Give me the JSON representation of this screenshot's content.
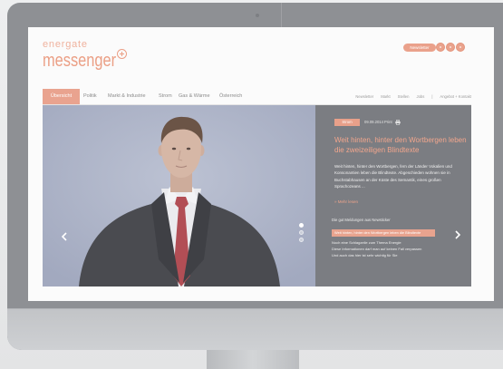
{
  "site": {
    "logo_top": "energate",
    "logo_main": "messenger"
  },
  "header": {
    "newsletter_button": "Newsletter",
    "icons": [
      "social-media-icon",
      "social-media-icon",
      "social-media-icon"
    ]
  },
  "nav": {
    "tabs": [
      {
        "label": "Übersicht",
        "active": true
      },
      {
        "label": "Politik",
        "active": false
      },
      {
        "label": "Markt & Industrie",
        "active": false
      },
      {
        "label": "Strom",
        "active": false
      },
      {
        "label": "Gas & Wärme",
        "active": false
      },
      {
        "label": "Österreich",
        "active": false
      }
    ],
    "links": [
      "Newsletter",
      "Markt",
      "Stellen",
      "Jobs"
    ],
    "separator": "|",
    "contact_link": "Angebot + Kontakt"
  },
  "hero": {
    "tag": "Strom",
    "date": "09.09.2014",
    "print_label": "Print",
    "headline": "Weit hinten, hinter den Wortbergen leben die zweizeiligen Blindtexte",
    "teaser": "Weit hinten, hinter den Wortbergen, fern der Länder Vokalien und Konsonantien leben die Blindtexte. Abgeschieden wohnen sie in Buchstabhausen an der Küste des Semantik, eines großen Sprachozeans ...",
    "more_link": "» Mehr lesen",
    "list_title": "Die gut Meldungen aus Newsticker",
    "list_items": [
      "Weit hinten, hinter den Wortbergen leben die Blindtexte",
      "Noch eine Schlagzeile zum Thema Energie",
      "Diese Informationen darf man auf keinen Fall verpassen",
      "Und auch das hier ist sehr wichtig für Sie"
    ],
    "slider": {
      "slides": 3,
      "active": 1
    },
    "icons": {
      "prev": "chevron-left-icon",
      "next": "chevron-right-icon",
      "print": "printer-icon"
    }
  },
  "colors": {
    "brand_orange": "#eb9f85",
    "panel": "#7b7d82",
    "bezel": "#8e9094",
    "screen": "#fbfbfb"
  }
}
